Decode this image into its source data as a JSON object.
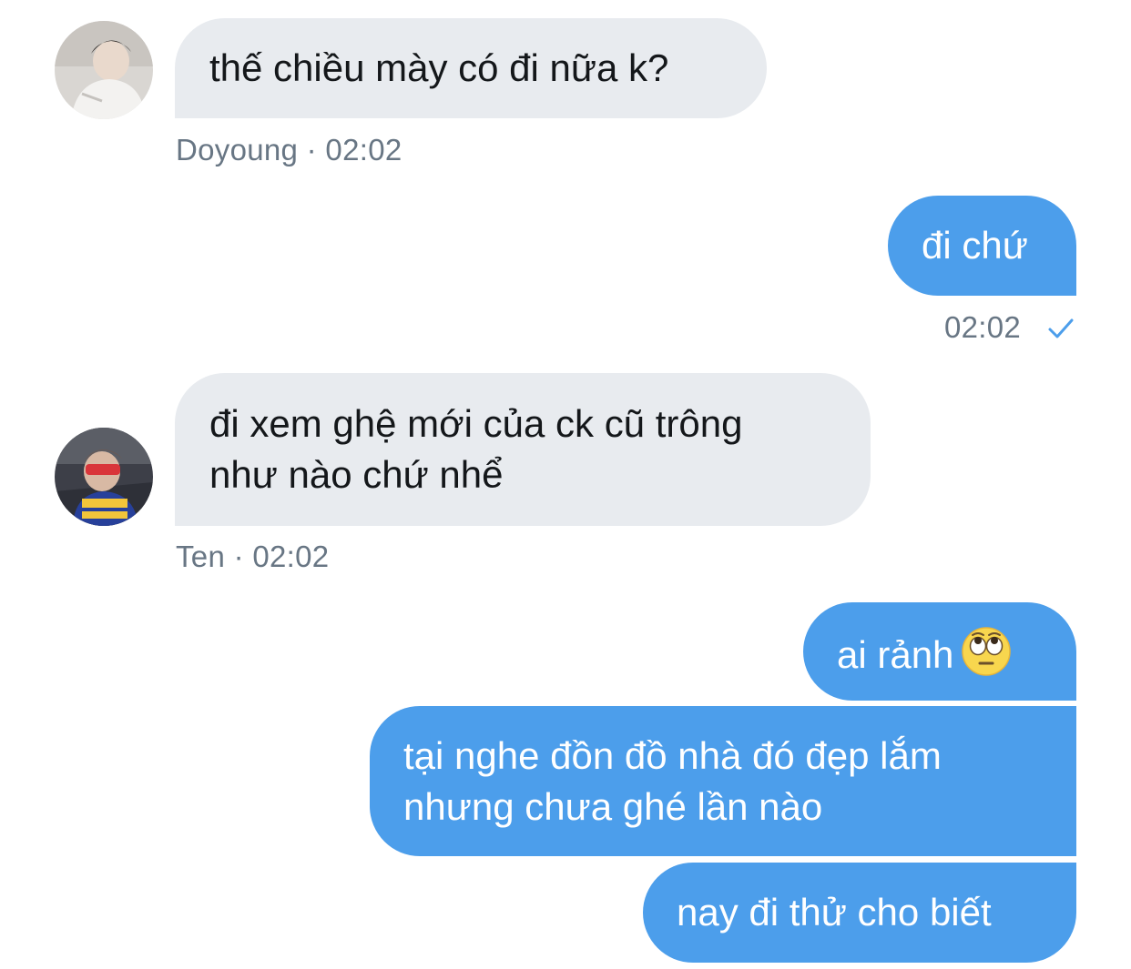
{
  "colors": {
    "incoming_bubble": "#e8ebef",
    "outgoing_bubble": "#4c9eeb",
    "meta_text": "#687684",
    "read_check": "#4c9eeb"
  },
  "messages": [
    {
      "direction": "incoming",
      "text": "thế chiều mày có đi nữa k?",
      "meta": "Doyoung · 02:02",
      "avatar_icon": "user-avatar-doyoung"
    },
    {
      "direction": "outgoing",
      "text": "đi chứ",
      "meta": "02:02",
      "status_icon": "check-icon"
    },
    {
      "direction": "incoming",
      "lines": [
        "đi xem ghệ mới của ck cũ trông",
        "như nào chứ nhể"
      ],
      "meta": "Ten · 02:02",
      "avatar_icon": "user-avatar-ten"
    },
    {
      "direction": "outgoing",
      "text": "ai rảnh",
      "emoji": "eye-roll-emoji"
    },
    {
      "direction": "outgoing",
      "lines": [
        "tại nghe đồn đồ nhà đó đẹp lắm",
        "nhưng chưa ghé lần nào"
      ]
    },
    {
      "direction": "outgoing",
      "text": "nay đi thử cho biết"
    }
  ]
}
